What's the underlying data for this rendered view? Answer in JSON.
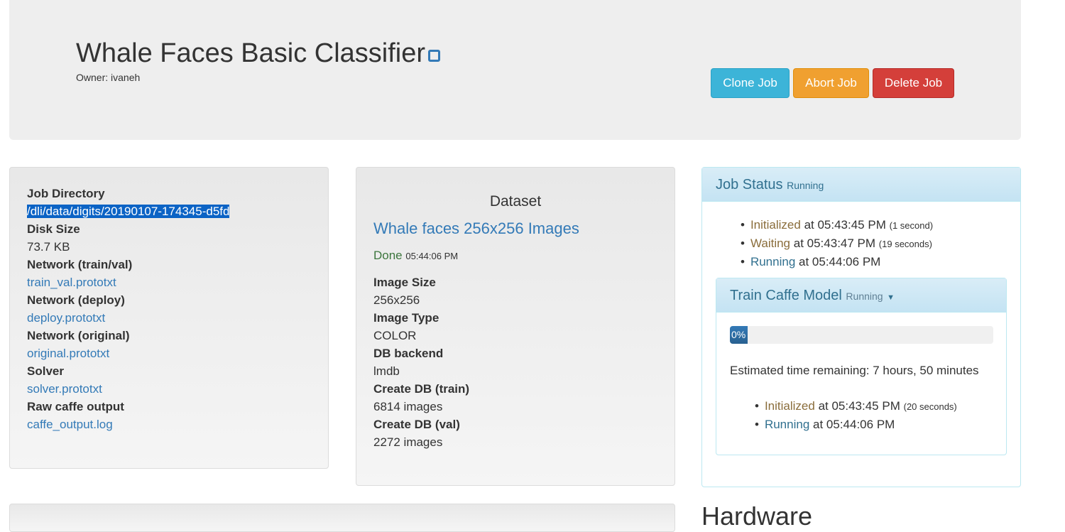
{
  "header": {
    "title": "Whale Faces Basic Classifier",
    "owner": "Owner: ivaneh",
    "buttons": {
      "clone": "Clone Job",
      "abort": "Abort Job",
      "delete": "Delete Job"
    }
  },
  "job_info": [
    {
      "label": "Job Directory",
      "value": "/dli/data/digits/20190107-174345-d5fd",
      "link": false
    },
    {
      "label": "Disk Size",
      "value": "73.7 KB",
      "link": false
    },
    {
      "label": "Network (train/val)",
      "value": "train_val.prototxt",
      "link": true
    },
    {
      "label": "Network (deploy)",
      "value": "deploy.prototxt",
      "link": true
    },
    {
      "label": "Network (original)",
      "value": "original.prototxt",
      "link": true
    },
    {
      "label": "Solver",
      "value": "solver.prototxt",
      "link": true
    },
    {
      "label": "Raw caffe output",
      "value": "caffe_output.log",
      "link": true
    }
  ],
  "dataset": {
    "heading": "Dataset",
    "name": "Whale faces 256x256 Images",
    "status": "Done",
    "status_time": "05:44:06 PM",
    "fields": [
      {
        "label": "Image Size",
        "value": "256x256"
      },
      {
        "label": "Image Type",
        "value": "COLOR"
      },
      {
        "label": "DB backend",
        "value": "lmdb"
      },
      {
        "label": "Create DB (train)",
        "value": "6814 images"
      },
      {
        "label": "Create DB (val)",
        "value": "2272 images"
      }
    ]
  },
  "job_status": {
    "title": "Job Status",
    "state": "Running",
    "events": [
      {
        "state": "Initialized",
        "time": "at 05:43:45 PM",
        "dur": "(1 second)"
      },
      {
        "state": "Waiting",
        "time": "at 05:43:47 PM",
        "dur": "(19 seconds)"
      },
      {
        "state": "Running",
        "time": "at 05:44:06 PM",
        "dur": ""
      }
    ],
    "task": {
      "title": "Train Caffe Model",
      "state": "Running",
      "progress_percent": 0,
      "progress_label": "0%",
      "eta": "Estimated time remaining: 7 hours, 50 minutes",
      "events": [
        {
          "state": "Initialized",
          "time": "at 05:43:45 PM",
          "dur": "(20 seconds)"
        },
        {
          "state": "Running",
          "time": "at 05:44:06 PM",
          "dur": ""
        }
      ]
    }
  },
  "hardware_heading": "Hardware",
  "colors": {
    "clone": "#31b0d5",
    "abort": "#ec971f",
    "delete": "#d9363e",
    "initialized": "#8a6d3b",
    "running": "#31708f"
  }
}
